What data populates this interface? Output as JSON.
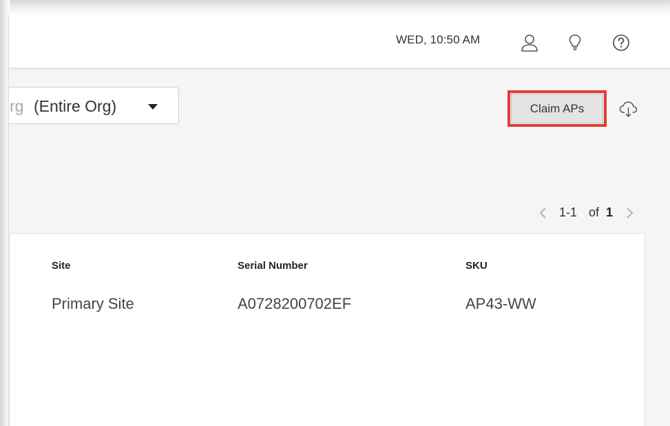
{
  "header": {
    "datetime": "WED, 10:50 AM",
    "icons": [
      "user-icon",
      "lightbulb-icon",
      "help-icon"
    ]
  },
  "org_filter": {
    "partial_text": "rg",
    "label": "(Entire Org)"
  },
  "toolbar": {
    "claim_button_label": "Claim APs",
    "download_icon": "cloud-download-icon"
  },
  "pagination": {
    "range": "1-1",
    "of_label": "of",
    "total": "1"
  },
  "table": {
    "columns": [
      "Site",
      "Serial Number",
      "SKU"
    ],
    "rows": [
      {
        "site": "Primary Site",
        "serial": "A0728200702EF",
        "sku": "AP43-WW"
      }
    ]
  },
  "colors": {
    "highlight": "#e23b31",
    "button_bg": "#e3e3e3",
    "page_bg": "#f5f5f5"
  }
}
